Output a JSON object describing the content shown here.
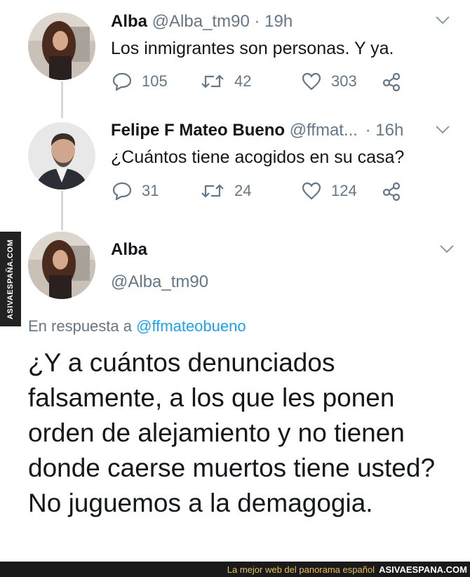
{
  "watermark": "ASIVAESPAÑA.COM",
  "tweets": [
    {
      "name": "Alba",
      "handle": "@Alba_tm90",
      "time": "· 19h",
      "text": "Los inmigrantes son personas. Y ya.",
      "replies": "105",
      "retweets": "42",
      "likes": "303"
    },
    {
      "name": "Felipe F Mateo Bueno",
      "handle": "@ffmat...",
      "time": "· 16h",
      "text": "¿Cuántos tiene acogidos en su casa?",
      "replies": "31",
      "retweets": "24",
      "likes": "124"
    }
  ],
  "main": {
    "name": "Alba",
    "handle": "@Alba_tm90",
    "reply_prefix": "En respuesta a",
    "reply_mention": "@ffmateobueno",
    "text": "¿Y a cuántos denunciados falsamente, a los que les ponen orden de alejamiento y no tienen donde caerse muertos tiene usted? No juguemos a la demagogia."
  },
  "footer": {
    "tagline": "La mejor web del panorama español",
    "site": "ASIVAESPANA.COM"
  },
  "icons": {
    "reply": "comment-bubble-icon",
    "retweet": "retweet-icon",
    "like": "heart-icon",
    "share": "share-icon",
    "menu": "chevron-down-icon"
  },
  "colors": {
    "link": "#1da1f2",
    "muted": "#657786",
    "text": "#14171a"
  }
}
